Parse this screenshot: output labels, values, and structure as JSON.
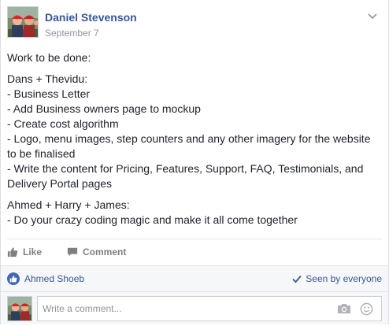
{
  "post": {
    "author": "Daniel Stevenson",
    "date": "September 7",
    "paragraphs": [
      [
        "Work to be done:"
      ],
      [
        "Dans + Thevidu:",
        "- Business Letter",
        "- Add Business owners page to mockup",
        "- Create cost algorithm",
        "- Logo, menu images, step counters and any other imagery for the website to be finalised",
        "- Write the content for Pricing, Features, Support, FAQ, Testimonials, and Delivery Portal pages"
      ],
      [
        "Ahmed + Harry + James:",
        "- Do your crazy coding magic and make it all come together"
      ]
    ]
  },
  "actions": {
    "like_label": "Like",
    "comment_label": "Comment"
  },
  "footer": {
    "liker": "Ahmed Shoeb",
    "seen_label": "Seen by everyone"
  },
  "comment_box": {
    "placeholder": "Write a comment..."
  },
  "colors": {
    "brand_blue": "#365899",
    "like_blue": "#4267b2",
    "muted": "#90949c"
  },
  "icons": {
    "menu": "chevron-down-icon",
    "like": "thumbs-up-icon",
    "comment": "speech-bubble-icon",
    "seen": "checkmark-icon",
    "camera": "camera-icon",
    "emoji": "smiley-icon"
  }
}
